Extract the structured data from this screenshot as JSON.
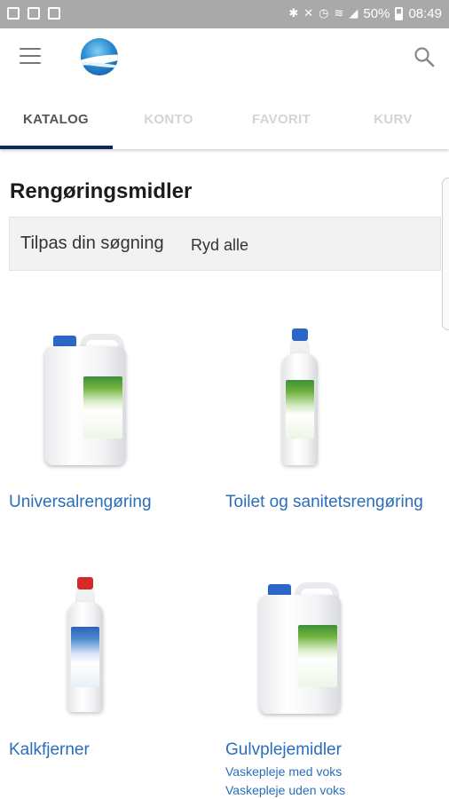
{
  "status_bar": {
    "battery": "50%",
    "time": "08:49"
  },
  "tabs": [
    {
      "label": "KATALOG",
      "active": true
    },
    {
      "label": "KONTO",
      "active": false
    },
    {
      "label": "FAVORIT",
      "active": false
    },
    {
      "label": "KURV",
      "active": false
    }
  ],
  "page": {
    "title": "Rengøringsmidler"
  },
  "filter": {
    "label": "Tilpas din søgning",
    "clear_label": "Ryd alle"
  },
  "products": [
    {
      "title": "Universalrengøring",
      "image": "canister-green-label",
      "subs": []
    },
    {
      "title": "Toilet og sanitetsrengøring",
      "image": "bottle-green-label",
      "subs": []
    },
    {
      "title": "Kalkfjerner",
      "image": "bottle-blue-label-red-cap",
      "subs": []
    },
    {
      "title": "Gulvplejemidler",
      "image": "canister-green-label",
      "subs": [
        "Vaskepleje med voks",
        "Vaskepleje uden voks"
      ]
    }
  ],
  "colors": {
    "accent": "#0b2a5b",
    "link": "#2a6ebb",
    "status_bar": "#a9a9a9"
  }
}
